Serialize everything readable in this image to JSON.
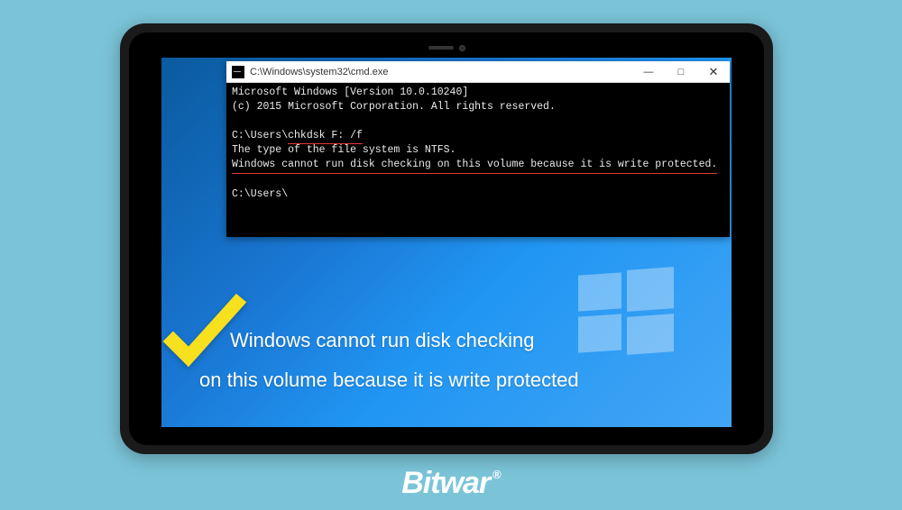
{
  "cmd": {
    "title": "C:\\Windows\\system32\\cmd.exe",
    "line1": "Microsoft Windows [Version 10.0.10240]",
    "line2": "(c) 2015 Microsoft Corporation. All rights reserved.",
    "prompt1a": "C:\\Users\\",
    "prompt1b": "chkdsk F: /f",
    "out1": "The type of the file system is NTFS.",
    "out2": "Windows cannot run disk checking on this volume because it is write protected.",
    "prompt2": "C:\\Users\\",
    "btn_min": "—",
    "btn_max": "□",
    "btn_close": "✕"
  },
  "caption": {
    "line1": "Windows cannot run disk checking",
    "line2": "on this volume because it is write protected"
  },
  "brand": {
    "name": "Bitwar",
    "reg": "®"
  }
}
